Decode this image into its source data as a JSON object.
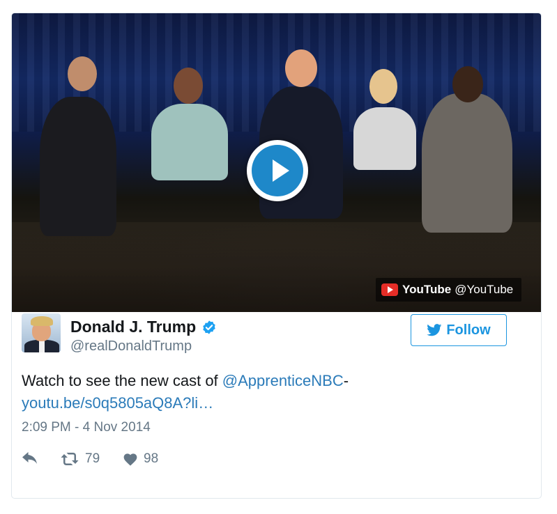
{
  "media": {
    "provider": "YouTube",
    "provider_handle": "@YouTube",
    "play_icon": "play-icon"
  },
  "author": {
    "name": "Donald J. Trump",
    "handle": "@realDonaldTrump",
    "verified_icon": "verified-badge-icon"
  },
  "follow_button": {
    "label": "Follow",
    "icon": "twitter-bird-icon"
  },
  "tweet": {
    "text_prefix": "Watch to see the new cast of ",
    "mention": "@ApprenticeNBC",
    "separator": "-",
    "url": "youtu.be/s0q5805aQ8A?li…",
    "timestamp": "2:09 PM - 4 Nov 2014"
  },
  "actions": {
    "reply_icon": "reply-icon",
    "retweet_icon": "retweet-icon",
    "retweet_count": "79",
    "like_icon": "heart-icon",
    "like_count": "98"
  },
  "colors": {
    "accent": "#1b95e0",
    "link": "#2b7bb9",
    "muted": "#657786",
    "play": "#1e88c9",
    "youtube_red": "#e52d27"
  }
}
